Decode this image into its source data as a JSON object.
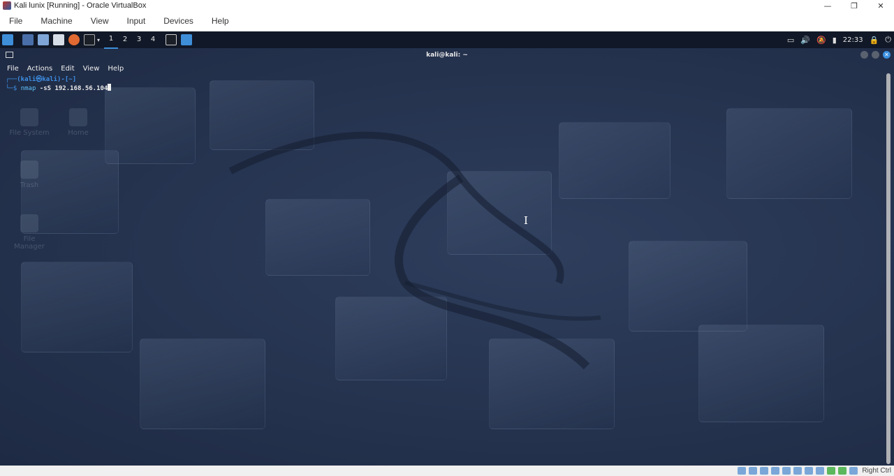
{
  "host": {
    "window_title": "Kali lunix [Running] - Oracle VirtualBox",
    "menu": [
      "File",
      "Machine",
      "View",
      "Input",
      "Devices",
      "Help"
    ],
    "window_controls": [
      "—",
      "❐",
      "✕"
    ],
    "status_hostkey": "Right Ctrl"
  },
  "panel": {
    "workspaces": [
      "1",
      "2",
      "3",
      "4"
    ],
    "active_workspace": "1",
    "clock": "22:33"
  },
  "desktop": {
    "icons": [
      "File System",
      "Home",
      "Trash",
      "File Manager"
    ]
  },
  "terminal": {
    "title": "kali@kali: ~",
    "menu": [
      "File",
      "Actions",
      "Edit",
      "View",
      "Help"
    ],
    "prompt_line1": "┌──(kali㉿kali)-[~]",
    "prompt_line2_prefix": "└─$ ",
    "command": "nmap",
    "args": "-sS 192.168.56.104"
  },
  "colors": {
    "panel_bg": "#111827",
    "desktop_bg": "#25334f",
    "prompt_blue": "#3d8fe6",
    "accent": "#3e8ed8"
  }
}
